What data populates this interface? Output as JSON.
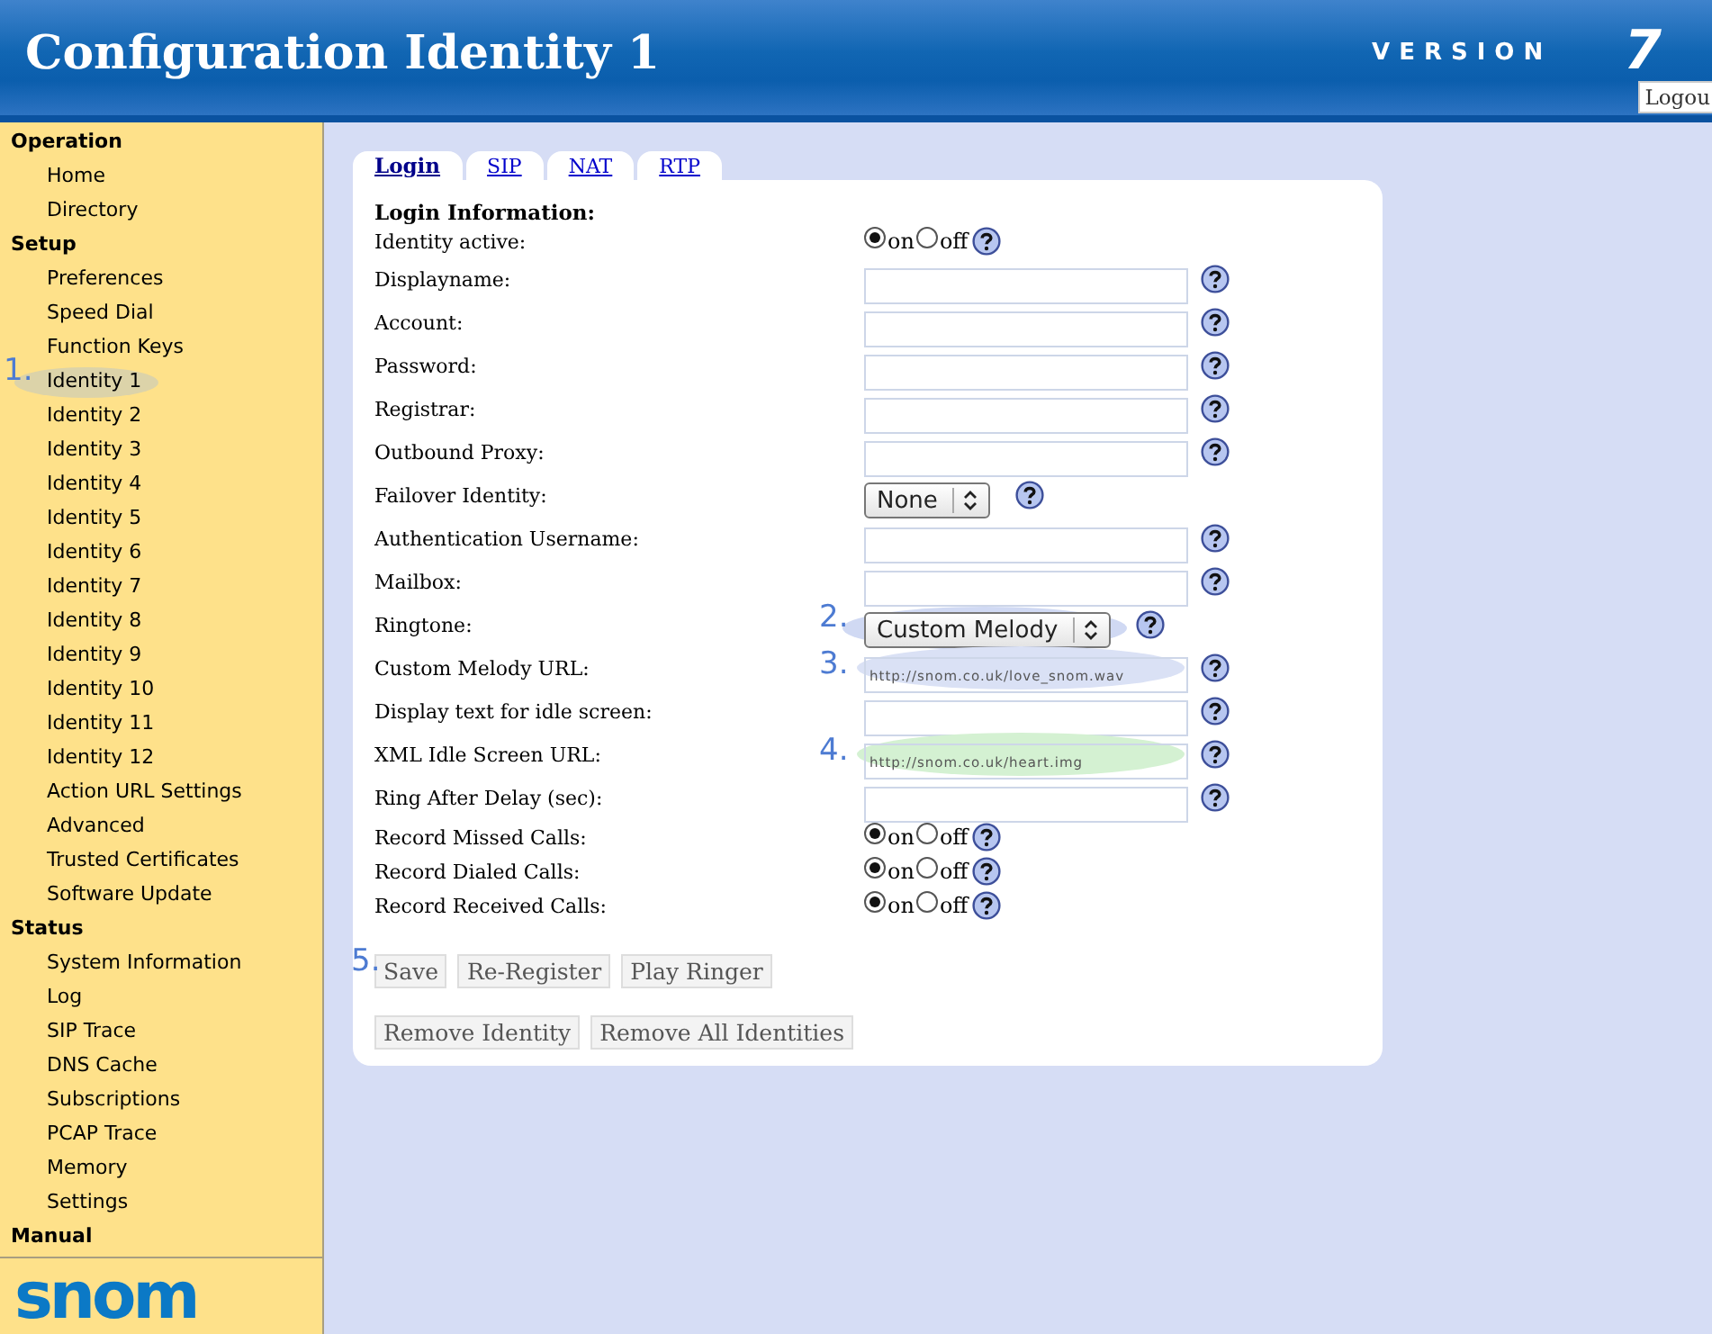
{
  "header": {
    "title": "Configuration Identity 1",
    "version_label": "VERSION",
    "version_number": "7",
    "logout": "Logou"
  },
  "sidebar": {
    "sections": [
      {
        "title": "Operation",
        "items": [
          {
            "label": "Home"
          },
          {
            "label": "Directory"
          }
        ]
      },
      {
        "title": "Setup",
        "items": [
          {
            "label": "Preferences"
          },
          {
            "label": "Speed Dial"
          },
          {
            "label": "Function Keys"
          },
          {
            "label": "Identity 1",
            "annotation": {
              "number": "1.",
              "color": "#dcd3a9"
            }
          },
          {
            "label": "Identity 2"
          },
          {
            "label": "Identity 3"
          },
          {
            "label": "Identity 4"
          },
          {
            "label": "Identity 5"
          },
          {
            "label": "Identity 6"
          },
          {
            "label": "Identity 7"
          },
          {
            "label": "Identity 8"
          },
          {
            "label": "Identity 9"
          },
          {
            "label": "Identity 10"
          },
          {
            "label": "Identity 11"
          },
          {
            "label": "Identity 12"
          },
          {
            "label": "Action URL Settings"
          },
          {
            "label": "Advanced"
          },
          {
            "label": "Trusted Certificates"
          },
          {
            "label": "Software Update"
          }
        ]
      },
      {
        "title": "Status",
        "items": [
          {
            "label": "System Information"
          },
          {
            "label": "Log"
          },
          {
            "label": "SIP Trace"
          },
          {
            "label": "DNS Cache"
          },
          {
            "label": "Subscriptions"
          },
          {
            "label": "PCAP Trace"
          },
          {
            "label": "Memory"
          },
          {
            "label": "Settings"
          }
        ]
      },
      {
        "title": "Manual"
      }
    ],
    "logo": "snom"
  },
  "tabs": [
    {
      "label": "Login",
      "selected": true
    },
    {
      "label": "SIP",
      "selected": false
    },
    {
      "label": "NAT",
      "selected": false
    },
    {
      "label": "RTP",
      "selected": false
    }
  ],
  "form": {
    "heading": "Login Information:",
    "rows": [
      {
        "kind": "radio",
        "label": "Identity active:",
        "options": [
          {
            "label": "on",
            "selected": true
          },
          {
            "label": "off",
            "selected": false
          }
        ]
      },
      {
        "kind": "text",
        "label": "Displayname:"
      },
      {
        "kind": "text",
        "label": "Account:"
      },
      {
        "kind": "text",
        "label": "Password:"
      },
      {
        "kind": "text",
        "label": "Registrar:"
      },
      {
        "kind": "text",
        "label": "Outbound Proxy:"
      },
      {
        "kind": "select",
        "label": "Failover Identity:",
        "value": "None"
      },
      {
        "kind": "text",
        "label": "Authentication Username:"
      },
      {
        "kind": "text",
        "label": "Mailbox:"
      },
      {
        "kind": "select",
        "label": "Ringtone:",
        "value": "Custom Melody",
        "annotation": {
          "number": "2.",
          "color": "#d0d9f3"
        }
      },
      {
        "kind": "text",
        "label": "Custom Melody URL:",
        "value": "http://snom.co.uk/love_snom.wav",
        "annotation": {
          "number": "3.",
          "color": "#dae1f5"
        }
      },
      {
        "kind": "text",
        "label": "Display text for idle screen:"
      },
      {
        "kind": "text",
        "label": "XML Idle Screen URL:",
        "value": "http://snom.co.uk/heart.img",
        "annotation": {
          "number": "4.",
          "color": "#d4f1d2"
        }
      },
      {
        "kind": "text",
        "label": "Ring After Delay (sec):"
      },
      {
        "kind": "radio",
        "label": "Record Missed Calls:",
        "options": [
          {
            "label": "on",
            "selected": true
          },
          {
            "label": "off",
            "selected": false
          }
        ]
      },
      {
        "kind": "radio",
        "label": "Record Dialed Calls:",
        "options": [
          {
            "label": "on",
            "selected": true
          },
          {
            "label": "off",
            "selected": false
          }
        ]
      },
      {
        "kind": "radio",
        "label": "Record Received Calls:",
        "options": [
          {
            "label": "on",
            "selected": true
          },
          {
            "label": "off",
            "selected": false
          }
        ]
      }
    ],
    "buttons": [
      {
        "label": "Save",
        "annotation": {
          "number": "5."
        }
      },
      {
        "label": "Re-Register"
      },
      {
        "label": "Play Ringer"
      }
    ],
    "buttons_2": [
      {
        "label": "Remove Identity"
      },
      {
        "label": "Remove All Identities"
      }
    ]
  }
}
